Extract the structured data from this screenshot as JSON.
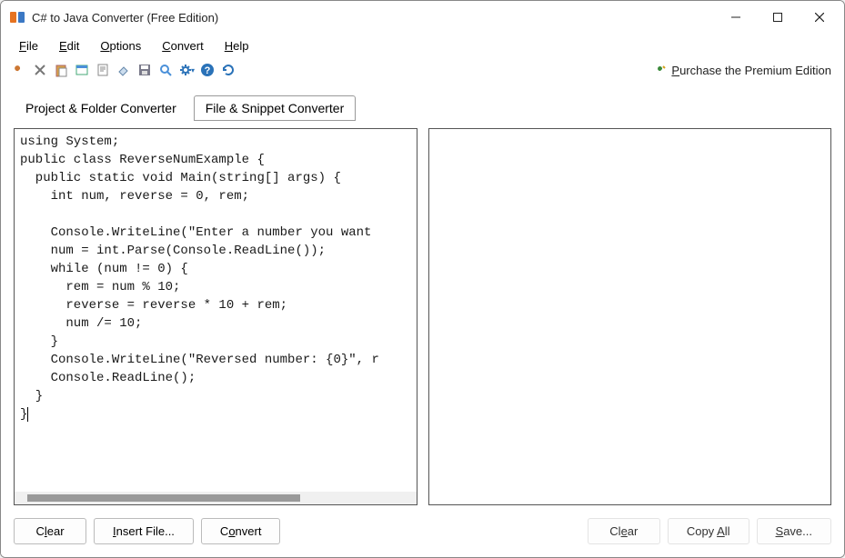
{
  "window": {
    "title": "C# to Java Converter (Free Edition)"
  },
  "menu": {
    "file": "File",
    "edit": "Edit",
    "options": "Options",
    "convert": "Convert",
    "help": "Help"
  },
  "toolbar": {
    "premium_label": "Purchase the Premium Edition"
  },
  "tabs": {
    "project": "Project & Folder Converter",
    "snippet": "File & Snippet Converter"
  },
  "code": {
    "input": "using System;\npublic class ReverseNumExample {\n  public static void Main(string[] args) {\n    int num, reverse = 0, rem;\n\n    Console.WriteLine(\"Enter a number you want \n    num = int.Parse(Console.ReadLine());\n    while (num != 0) {\n      rem = num % 10;\n      reverse = reverse * 10 + rem;\n      num /= 10;\n    }\n    Console.WriteLine(\"Reversed number: {0}\", r\n    Console.ReadLine();\n  }\n}",
    "output": ""
  },
  "buttons": {
    "clear_left": "Clear",
    "insert_file": "Insert File...",
    "convert": "Convert",
    "clear_right": "Clear",
    "copy_all": "Copy All",
    "save": "Save..."
  }
}
